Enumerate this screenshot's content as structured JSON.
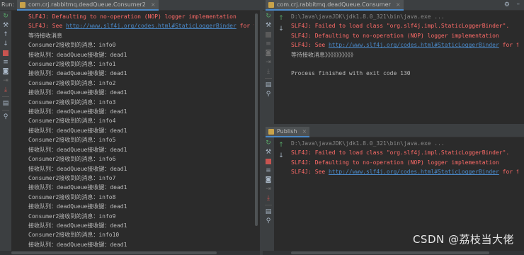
{
  "left": {
    "side_label": "Run:",
    "tab_title": "com.crj.rabbitmq.deadQueue.Consumer2",
    "tab_close": "×",
    "lines": [
      {
        "kind": "err",
        "text": "SLF4J: Defaulting to no-operation (NOP) logger implementation"
      },
      {
        "kind": "err",
        "text": "SLF4J: See ",
        "link": "http://www.slf4j.org/codes.html#StaticLoggerBinder",
        "after": " for fur"
      },
      {
        "kind": "normal",
        "text": "等待接收消息"
      },
      {
        "kind": "normal",
        "text": "Consumer2接收到的消息：info0"
      },
      {
        "kind": "normal",
        "text": "接收队列：deadQueue接收键：dead1"
      },
      {
        "kind": "normal",
        "text": "Consumer2接收到的消息：info1"
      },
      {
        "kind": "normal",
        "text": "接收队列：deadQueue接收键：dead1"
      },
      {
        "kind": "normal",
        "text": "Consumer2接收到的消息：info2"
      },
      {
        "kind": "normal",
        "text": "接收队列：deadQueue接收键：dead1"
      },
      {
        "kind": "normal",
        "text": "Consumer2接收到的消息：info3"
      },
      {
        "kind": "normal",
        "text": "接收队列：deadQueue接收键：dead1"
      },
      {
        "kind": "normal",
        "text": "Consumer2接收到的消息：info4"
      },
      {
        "kind": "normal",
        "text": "接收队列：deadQueue接收键：dead1"
      },
      {
        "kind": "normal",
        "text": "Consumer2接收到的消息：info5"
      },
      {
        "kind": "normal",
        "text": "接收队列：deadQueue接收键：dead1"
      },
      {
        "kind": "normal",
        "text": "Consumer2接收到的消息：info6"
      },
      {
        "kind": "normal",
        "text": "接收队列：deadQueue接收键：dead1"
      },
      {
        "kind": "normal",
        "text": "Consumer2接收到的消息：info7"
      },
      {
        "kind": "normal",
        "text": "接收队列：deadQueue接收键：dead1"
      },
      {
        "kind": "normal",
        "text": "Consumer2接收到的消息：info8"
      },
      {
        "kind": "normal",
        "text": "接收队列：deadQueue接收键：dead1"
      },
      {
        "kind": "normal",
        "text": "Consumer2接收到的消息：info9"
      },
      {
        "kind": "normal",
        "text": "接收队列：deadQueue接收键：dead1"
      },
      {
        "kind": "normal",
        "text": "Consumer2接收到的消息：info10"
      },
      {
        "kind": "normal",
        "text": "接收队列：deadQueue接收键：dead1"
      }
    ]
  },
  "right_top": {
    "tab_title": "com.crj.rabbitmq.deadQueue.Consumer",
    "tab_close": "×",
    "lines": [
      {
        "kind": "gray",
        "text": "D:\\Java\\javaJDK\\jdk1.8.0_321\\bin\\java.exe ..."
      },
      {
        "kind": "err",
        "text": "SLF4J: Failed to load class \"org.slf4j.impl.StaticLoggerBinder\"."
      },
      {
        "kind": "err",
        "text": "SLF4J: Defaulting to no-operation (NOP) logger implementation"
      },
      {
        "kind": "err",
        "text": "SLF4J: See ",
        "link": "http://www.slf4j.org/codes.html#StaticLoggerBinder",
        "after": " for fur"
      },
      {
        "kind": "normal",
        "text": "等待接收消息》》》》》》》》》》"
      },
      {
        "kind": "normal",
        "text": ""
      },
      {
        "kind": "normal",
        "text": "Process finished with exit code 130"
      }
    ]
  },
  "right_bottom": {
    "tab_title": "Publish",
    "tab_close": "×",
    "lines": [
      {
        "kind": "gray",
        "text": "D:\\Java\\javaJDK\\jdk1.8.0_321\\bin\\java.exe ..."
      },
      {
        "kind": "err",
        "text": "SLF4J: Failed to load class \"org.slf4j.impl.StaticLoggerBinder\"."
      },
      {
        "kind": "err",
        "text": "SLF4J: Defaulting to no-operation (NOP) logger implementation"
      },
      {
        "kind": "err",
        "text": "SLF4J: See ",
        "link": "http://www.slf4j.org/codes.html#StaticLoggerBinder",
        "after": " for fur"
      }
    ]
  },
  "watermark": "CSDN @荔枝当大佬",
  "colors": {
    "error_text": "#ff6b68",
    "link": "#4a88c7",
    "normal_text": "#bbbbbb",
    "background": "#2b2b2b"
  }
}
